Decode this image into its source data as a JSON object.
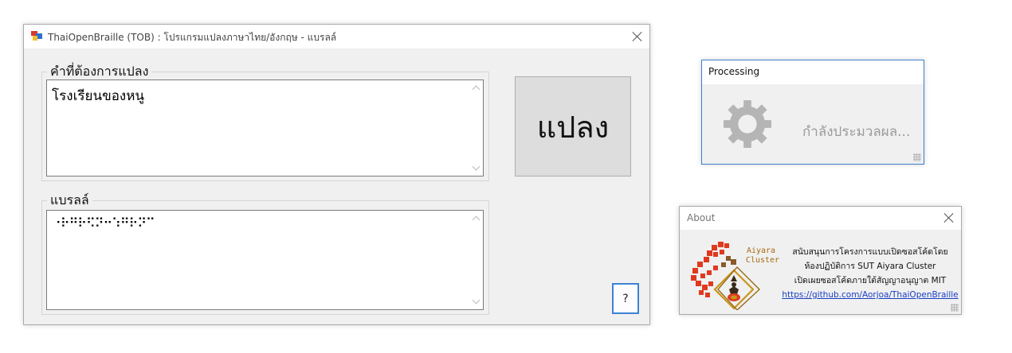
{
  "main_window": {
    "title": "ThaiOpenBraille (TOB) : โปรแกรมแปลงภาษาไทย/อังกฤษ - แบรลล์",
    "input_group_label": "คำที่ต้องการแปลง",
    "input_text": "โรงเรียนของหนู",
    "output_group_label": "แบรลล์",
    "output_text": "⠐⠗⠛⠗⠫⠝⠒⠱⠛⠗⠝⠉",
    "translate_button": "แปลง",
    "help_button": "?"
  },
  "processing_dialog": {
    "title": "Processing",
    "status_text": "กำลังประมวลผล...",
    "icon": "gear-icon"
  },
  "about_dialog": {
    "title": "About",
    "logo_text_line1": "Aiyara",
    "logo_text_line2": "Cluster",
    "line1": "สนับสนุนการโครงการแบบเปิดซอสโค้ดโดย",
    "line2": "ห้องปฏิบัติการ SUT Aiyara Cluster",
    "line3": "เปิดเผยซอสโค้ดภายใต้สัญญาอนุญาต MIT",
    "link": "https://github.com/Aorjoa/ThaiOpenBraille"
  },
  "colors": {
    "window_bg": "#f0f0f0",
    "focus_border": "#3b82d6",
    "link": "#1a3ec4",
    "logo_red": "#e0391f",
    "logo_gold": "#c8961e"
  }
}
